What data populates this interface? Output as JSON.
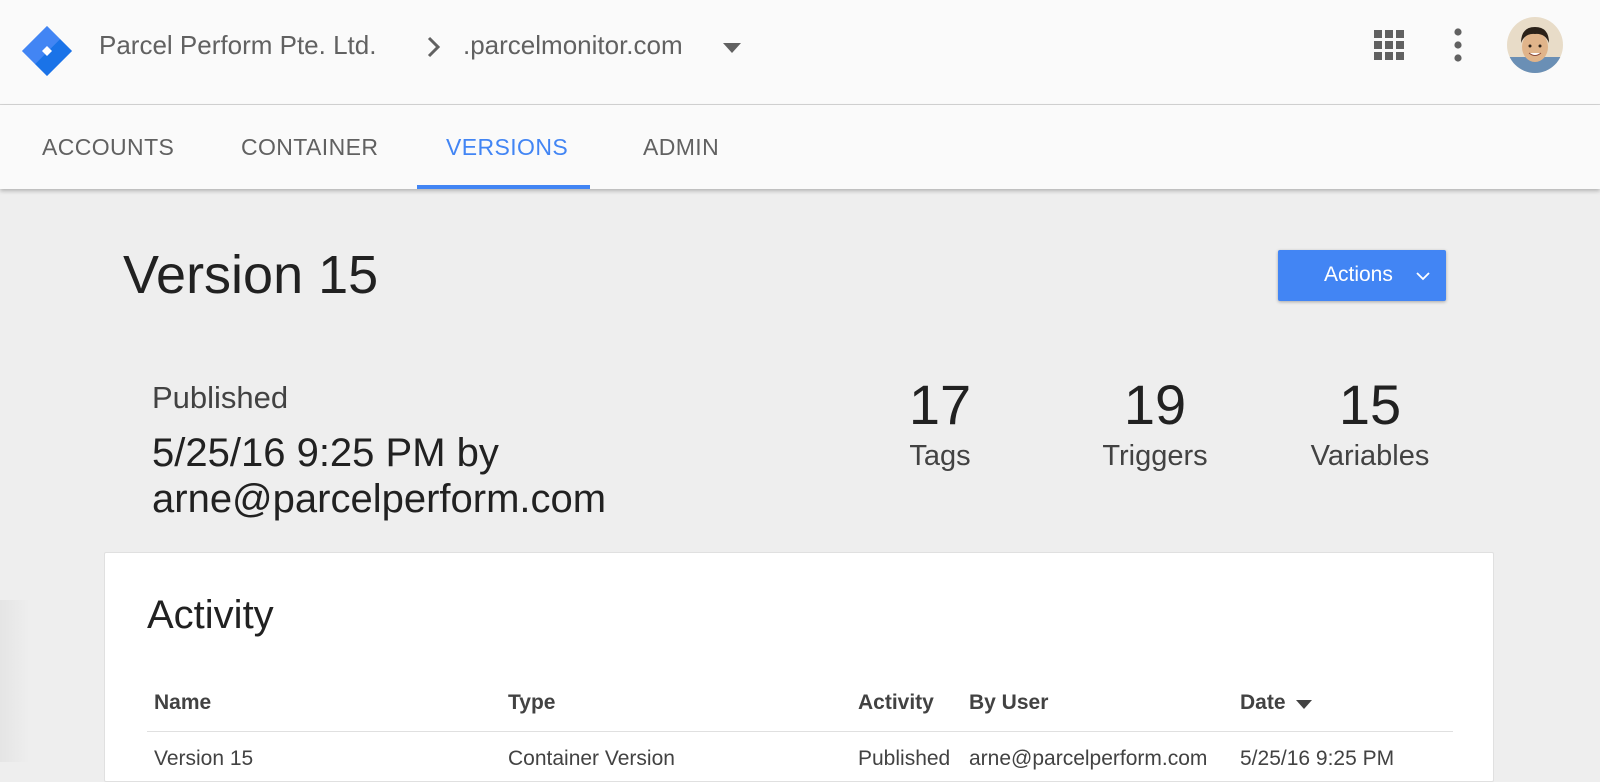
{
  "header": {
    "account_name": "Parcel Perform Pte. Ltd.",
    "container_name": ".parcelmonitor.com",
    "logo_icon": "gtm-diamond-icon",
    "apps_icon": "apps-grid-icon",
    "more_icon": "more-vert-icon"
  },
  "tabs": [
    {
      "label": "ACCOUNTS"
    },
    {
      "label": "CONTAINER"
    },
    {
      "label": "VERSIONS",
      "active": true
    },
    {
      "label": "ADMIN"
    }
  ],
  "version": {
    "title": "Version 15",
    "actions_label": "Actions",
    "status_label": "Published",
    "status_detail": "5/25/16 9:25 PM by arne@parcelperform.com"
  },
  "stats": [
    {
      "value": "17",
      "label": "Tags"
    },
    {
      "value": "19",
      "label": "Triggers"
    },
    {
      "value": "15",
      "label": "Variables"
    }
  ],
  "activity": {
    "title": "Activity",
    "columns": [
      "Name",
      "Type",
      "Activity",
      "By User",
      "Date"
    ],
    "rows": [
      [
        "Version 15",
        "Container Version",
        "Published",
        "arne@parcelperform.com",
        "5/25/16 9:25 PM"
      ]
    ]
  },
  "colors": {
    "accent": "#4285f4",
    "background": "#eeeeee",
    "header_bg": "#fafafa"
  }
}
